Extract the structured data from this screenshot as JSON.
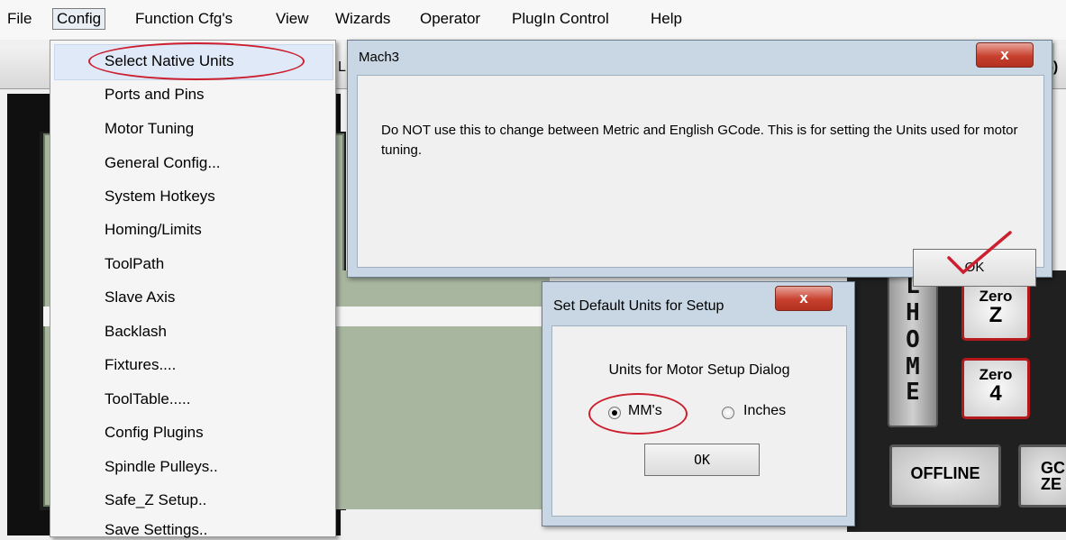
{
  "menubar": {
    "items": [
      "File",
      "Config",
      "Function Cfg's",
      "View",
      "Wizards",
      "Operator",
      "PlugIn Control",
      "Help"
    ],
    "active": "Config"
  },
  "config_menu": {
    "items": [
      "Select Native Units",
      "Ports and Pins",
      "Motor Tuning",
      "General Config...",
      "System Hotkeys",
      "Homing/Limits",
      "ToolPath",
      "Slave Axis",
      "Backlash",
      "Fixtures....",
      "ToolTable.....",
      "Config Plugins",
      "Spindle Pulleys..",
      "Safe_Z Setup..",
      "Save Settings.."
    ],
    "highlighted": "Select Native Units"
  },
  "mach3_dialog": {
    "title": "Mach3",
    "message": "Do NOT use this to change between Metric and English GCode. This is for setting the Units used for motor tuning.",
    "ok_label": "OK",
    "close_label": "x"
  },
  "units_dialog": {
    "title": "Set Default Units for Setup",
    "label": "Units for Motor Setup Dialog",
    "options": [
      "MM's",
      "Inches"
    ],
    "selected": "MM's",
    "ok_label": "OK",
    "close_label": "x"
  },
  "background": {
    "readout_fragment": "6)",
    "home_letters": [
      "L",
      "H",
      "O",
      "M",
      "E"
    ],
    "zero_buttons": [
      {
        "top": "Zero",
        "axis": "Z"
      },
      {
        "top": "Zero",
        "axis": "4"
      }
    ],
    "offline_label": "OFFLINE",
    "goto_zero_lines": [
      "GC",
      "ZE"
    ],
    "menu_fragment": "L"
  },
  "colors": {
    "highlight_oval": "#cc1f2f",
    "dialog_frame": "#c9d7e4",
    "close_button": "#c8402e",
    "dro_green": "#a8b6a0"
  }
}
